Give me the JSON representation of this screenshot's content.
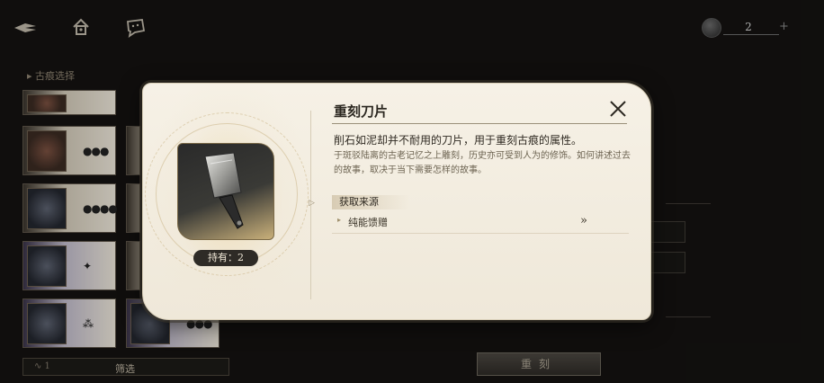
{
  "topbar": {
    "icons": [
      "back-arrow-icon",
      "home-icon",
      "chat-icon"
    ],
    "currency_value": "2",
    "currency_plus": "+"
  },
  "panel": {
    "section_title": "▸ 古痕选择",
    "filter_count": "∿ 1",
    "filter_label": "筛选",
    "recarve_label": "重刻"
  },
  "modal": {
    "title": "重刻刀片",
    "description": "削石如泥却并不耐用的刀片，用于重刻古痕的属性。",
    "flavor": "于斑驳陆离的古老记忆之上雕刻，历史亦可受到人为的修饰。如何讲述过去的故事，取决于当下需要怎样的故事。",
    "holding": "持有：2",
    "source_header": "获取来源",
    "sources": [
      {
        "label": "纯能馈赠"
      }
    ],
    "go_symbol": "»"
  },
  "colors": {
    "modal_bg": "#f6f1e6",
    "accent_gold": "#c9b07a",
    "dark_text": "#2b2720",
    "page_bg": "#141210"
  }
}
